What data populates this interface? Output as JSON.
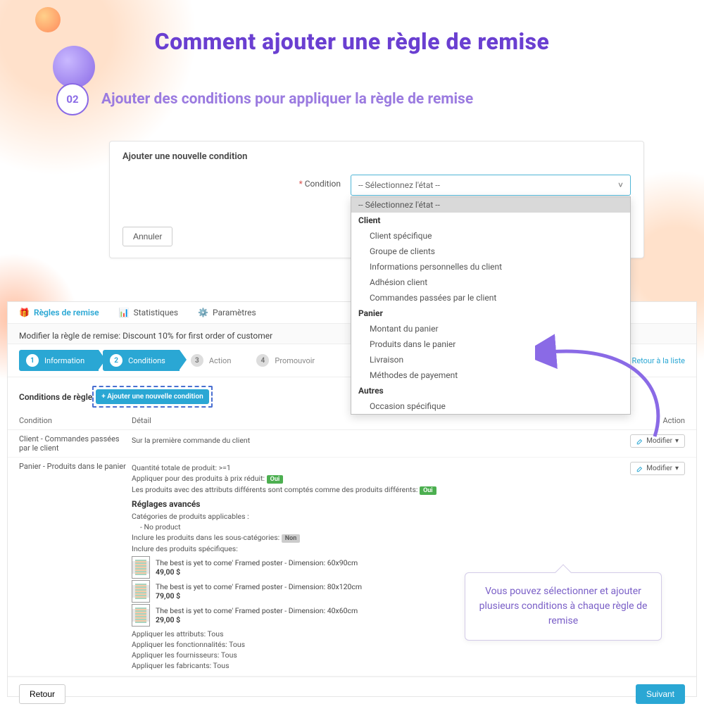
{
  "title": "Comment ajouter une règle de remise",
  "step": {
    "num": "02",
    "label": "Ajouter des conditions pour appliquer la règle de remise"
  },
  "dropdown_panel": {
    "title": "Ajouter une nouvelle condition",
    "field_label": "Condition",
    "placeholder": "-- Sélectionnez l'état --",
    "cancel": "Annuler",
    "menu": {
      "selected": "-- Sélectionnez l'état --",
      "groups": [
        {
          "label": "Client",
          "items": [
            "Client spécifique",
            "Groupe de clients",
            "Informations personnelles du client",
            "Adhésion client",
            "Commandes passées par le client"
          ]
        },
        {
          "label": "Panier",
          "items": [
            "Montant du panier",
            "Produits dans le panier",
            "Livraison",
            "Méthodes de payement"
          ]
        },
        {
          "label": "Autres",
          "items": [
            "Occasion spécifique"
          ]
        }
      ]
    }
  },
  "admin": {
    "tabs": [
      {
        "label": "Règles de remise",
        "icon": "gift",
        "active": true
      },
      {
        "label": "Statistiques",
        "icon": "stats",
        "active": false
      },
      {
        "label": "Paramètres",
        "icon": "gear",
        "active": false
      }
    ],
    "subtitle": "Modifier la règle de remise: Discount 10% for first order of customer",
    "steps": [
      {
        "n": "1",
        "label": "Information",
        "active": true
      },
      {
        "n": "2",
        "label": "Conditions",
        "active": true
      },
      {
        "n": "3",
        "label": "Action",
        "active": false
      },
      {
        "n": "4",
        "label": "Promouvoir",
        "active": false
      }
    ],
    "back_link": "← Retour à la liste",
    "conditions_title": "Conditions de règle",
    "add_button": "+ Ajouter une nouvelle condition",
    "table": {
      "headers": {
        "condition": "Condition",
        "detail": "Détail",
        "action": "Action"
      },
      "modify": "Modifier"
    },
    "row1": {
      "condition": "Client - Commandes passées par le client",
      "detail": "Sur la première commande du client"
    },
    "row2": {
      "condition": "Panier - Produits dans le panier",
      "qty": "Quantité totale de produit: >=1",
      "apply_reduced": "Appliquer pour des produits à prix réduit:",
      "oui": "Oui",
      "diff_attr": "Les produits avec des attributs différents sont comptés comme des produits différents:",
      "adv_title": "Réglages avancés",
      "cat_label": "Catégories de produits applicables :",
      "cat_value": "- No product",
      "subcat_label": "Inclure les produits dans les sous-catégories:",
      "non": "Non",
      "specific_label": "Inclure des produits spécifiques:",
      "products": [
        {
          "name": "The best is yet to come' Framed poster - Dimension: 60x90cm",
          "price": "49,00 $"
        },
        {
          "name": "The best is yet to come' Framed poster - Dimension: 80x120cm",
          "price": "79,00 $"
        },
        {
          "name": "The best is yet to come' Framed poster - Dimension: 40x60cm",
          "price": "29,00 $"
        }
      ],
      "apply_attr": "Appliquer les attributs: Tous",
      "apply_func": "Appliquer les fonctionnalités: Tous",
      "apply_supp": "Appliquer les fournisseurs: Tous",
      "apply_manu": "Appliquer les fabricants: Tous"
    },
    "footer": {
      "back": "Retour",
      "next": "Suivant"
    }
  },
  "callout": "Vous pouvez sélectionner et ajouter plusieurs conditions à chaque règle de remise"
}
